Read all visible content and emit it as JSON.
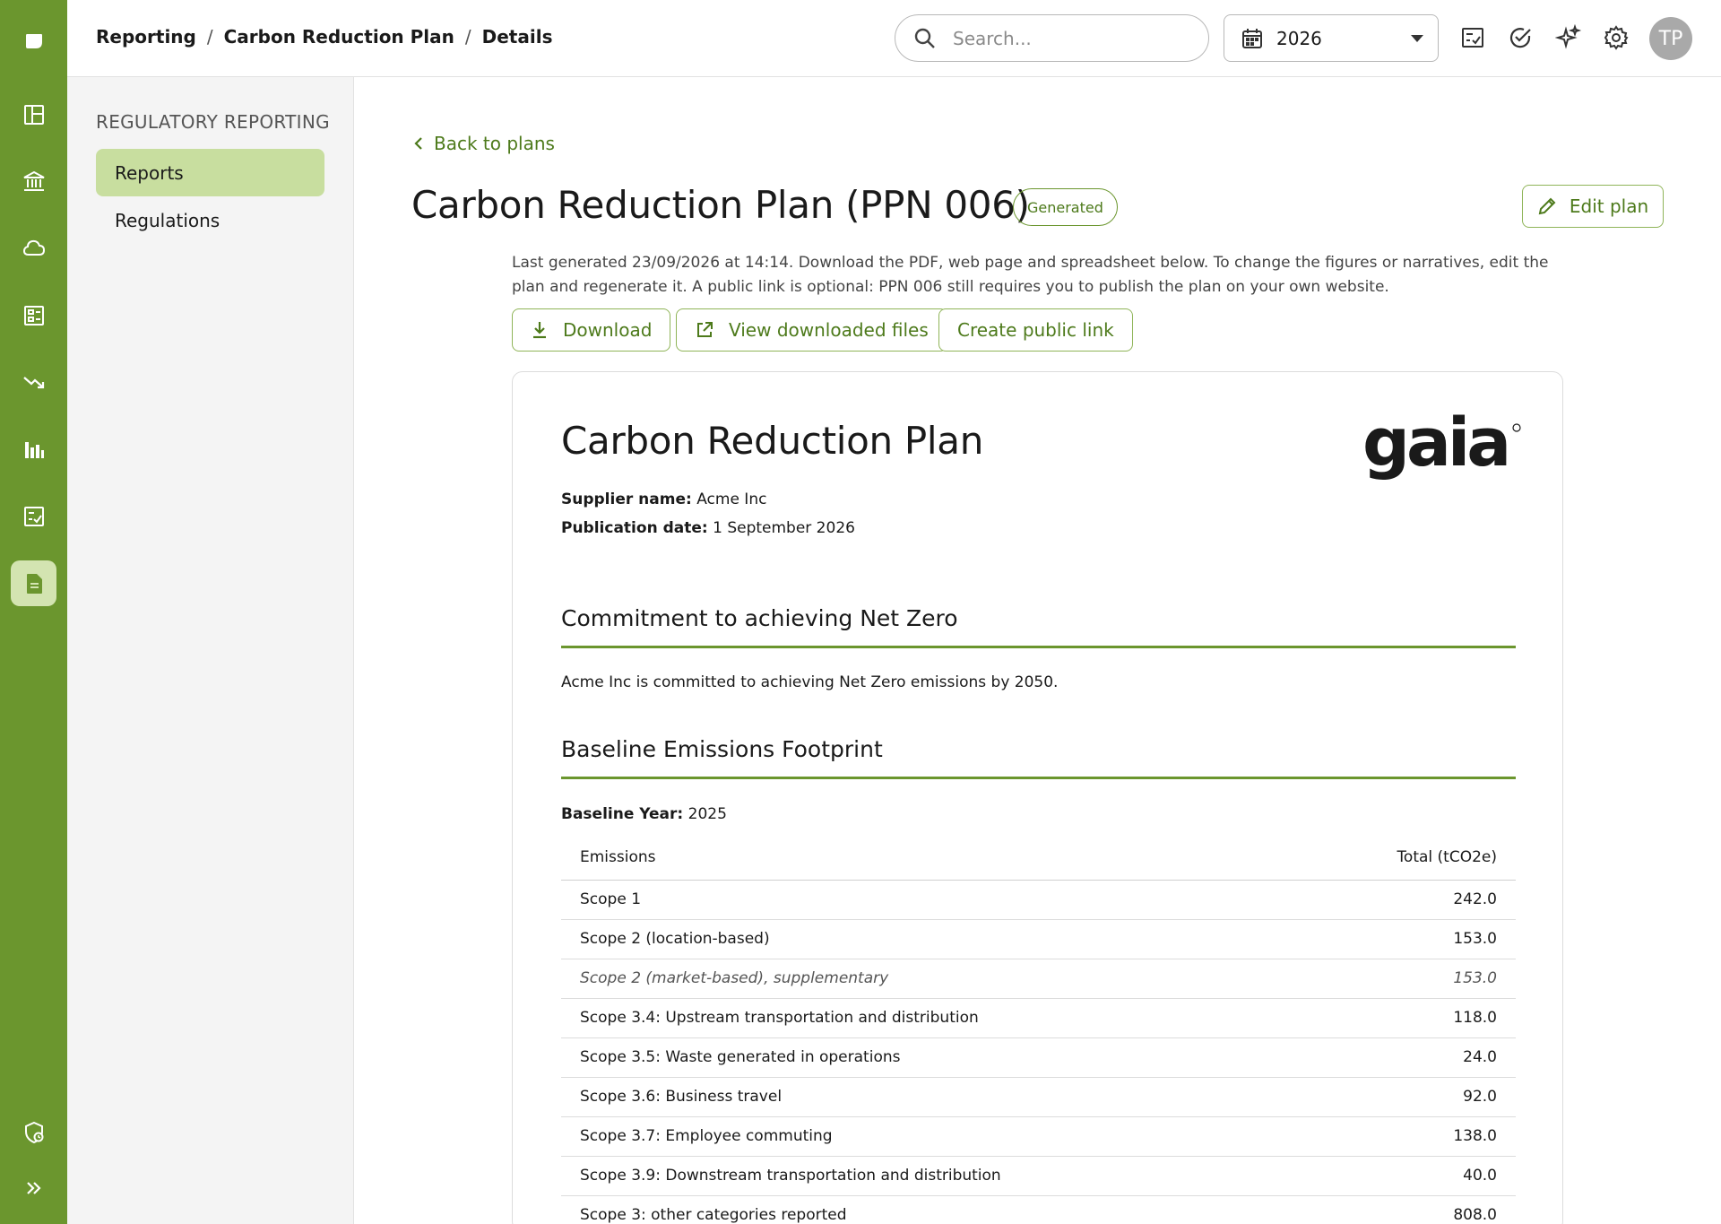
{
  "breadcrumb": [
    "Reporting",
    "Carbon Reduction Plan",
    "Details"
  ],
  "search": {
    "placeholder": "Search..."
  },
  "year_select": {
    "value": "2026"
  },
  "user": {
    "initials": "TP"
  },
  "subnav": {
    "heading": "REGULATORY REPORTING",
    "items": [
      {
        "label": "Reports",
        "active": true
      },
      {
        "label": "Regulations",
        "active": false
      }
    ]
  },
  "page": {
    "back_label": "Back to plans",
    "title": "Carbon Reduction Plan (PPN 006)",
    "status_badge": "Generated",
    "edit_label": "Edit plan",
    "description": "Last generated 23/09/2026 at 14:14. Download the PDF, web page and spreadsheet below. To change the figures or narratives, edit the plan and regenerate it. A public link is optional: PPN 006 still requires you to publish the plan on your own website.",
    "actions": {
      "download": "Download",
      "view_files": "View downloaded files",
      "public_link": "Create public link"
    }
  },
  "document": {
    "title": "Carbon Reduction Plan",
    "logo_text": "gaia",
    "supplier_label": "Supplier name:",
    "supplier_value": "Acme Inc",
    "publication_label": "Publication date:",
    "publication_value": "1 September 2026",
    "commitment_heading": "Commitment to achieving Net Zero",
    "commitment_text": "Acme Inc is committed to achieving Net Zero emissions by 2050.",
    "baseline_heading": "Baseline Emissions Footprint",
    "baseline_year_label": "Baseline Year:",
    "baseline_year_value": "2025",
    "table": {
      "headers": [
        "Emissions",
        "Total (tCO2e)"
      ],
      "rows": [
        {
          "label": "Scope 1",
          "value": "242.0"
        },
        {
          "label": "Scope 2 (location-based)",
          "value": "153.0"
        },
        {
          "label": "Scope 2 (market-based), supplementary",
          "value": "153.0",
          "supplementary": true
        },
        {
          "label": "Scope 3.4: Upstream transportation and distribution",
          "value": "118.0"
        },
        {
          "label": "Scope 3.5: Waste generated in operations",
          "value": "24.0"
        },
        {
          "label": "Scope 3.6: Business travel",
          "value": "92.0"
        },
        {
          "label": "Scope 3.7: Employee commuting",
          "value": "138.0"
        },
        {
          "label": "Scope 3.9: Downstream transportation and distribution",
          "value": "40.0"
        },
        {
          "label": "Scope 3: other categories reported",
          "value": "808.0"
        }
      ]
    }
  },
  "colors": {
    "brand": "#6b962e",
    "brand_text": "#4d7a1b",
    "active_bg": "#c8de9f"
  },
  "icons": {
    "rail": [
      "logo-icon",
      "dashboard-icon",
      "bank-icon",
      "cloud-icon",
      "report-icon",
      "trend-down-icon",
      "bar-chart-icon",
      "checklist-icon",
      "document-icon",
      "shield-clock-icon",
      "expand-icon"
    ],
    "topbar": [
      "search-icon",
      "calendar-icon",
      "checklist-icon",
      "check-circle-icon",
      "sparkles-icon",
      "gear-icon"
    ]
  }
}
